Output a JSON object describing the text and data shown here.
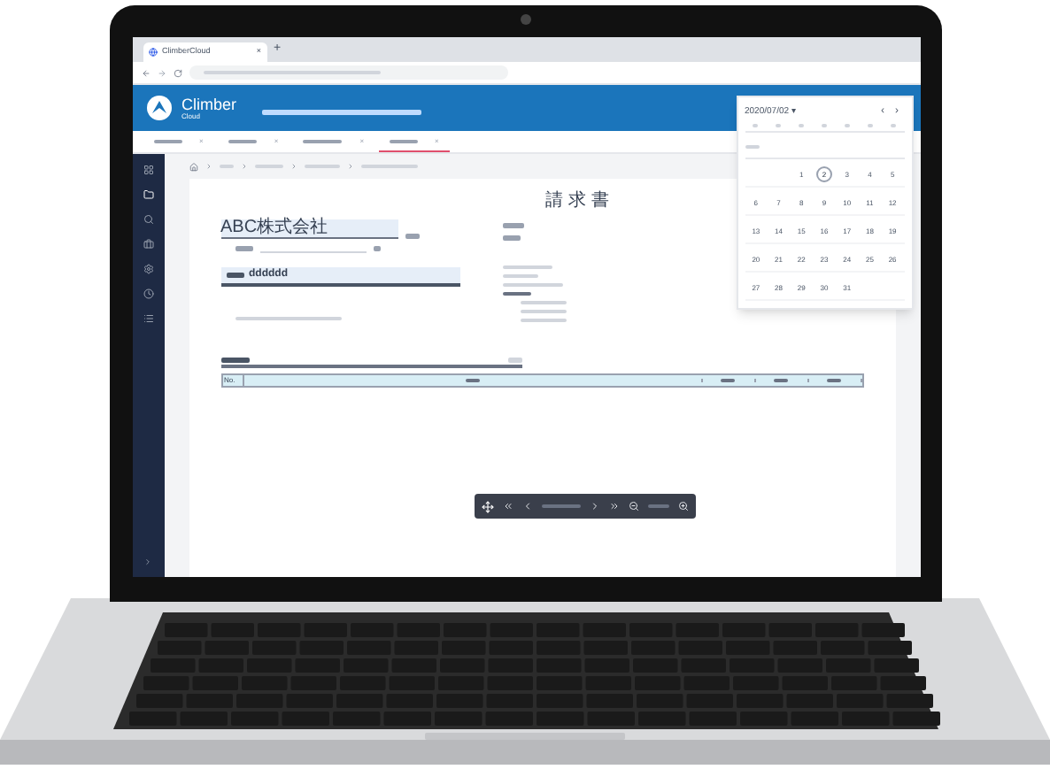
{
  "browser": {
    "tab_title": "ClimberCloud",
    "close": "×",
    "new_tab": "+"
  },
  "header": {
    "logo_main": "Climber",
    "logo_sub": "Cloud"
  },
  "app_tabs": [
    {
      "close": "×",
      "selected": false
    },
    {
      "close": "×",
      "selected": false
    },
    {
      "close": "×",
      "selected": false
    },
    {
      "close": "×",
      "selected": true
    }
  ],
  "document": {
    "title": "請 求 書",
    "customer": "ABC株式会社",
    "subject": "dddddd",
    "first_column": "No."
  },
  "calendar": {
    "month_label": "2020/07/02 ▾",
    "prev": "‹",
    "next": "›",
    "weeks": [
      [
        {
          "day": "1",
          "selected": false
        },
        {
          "day": "2",
          "selected": true
        },
        {
          "day": "3",
          "selected": false
        },
        {
          "day": "4",
          "selected": false
        },
        {
          "day": "5",
          "selected": false
        }
      ],
      [
        {
          "day": "6",
          "selected": false
        },
        {
          "day": "7",
          "selected": false
        },
        {
          "day": "8",
          "selected": false
        },
        {
          "day": "9",
          "selected": false
        },
        {
          "day": "10",
          "selected": false
        },
        {
          "day": "11",
          "selected": false
        },
        {
          "day": "12",
          "selected": false
        }
      ],
      [
        {
          "day": "13",
          "selected": false
        },
        {
          "day": "14",
          "selected": false
        },
        {
          "day": "15",
          "selected": false
        },
        {
          "day": "16",
          "selected": false
        },
        {
          "day": "17",
          "selected": false
        },
        {
          "day": "18",
          "selected": false
        },
        {
          "day": "19",
          "selected": false
        }
      ],
      [
        {
          "day": "20",
          "selected": false
        },
        {
          "day": "21",
          "selected": false
        },
        {
          "day": "22",
          "selected": false
        },
        {
          "day": "23",
          "selected": false
        },
        {
          "day": "24",
          "selected": false
        },
        {
          "day": "25",
          "selected": false
        },
        {
          "day": "26",
          "selected": false
        }
      ],
      [
        {
          "day": "27",
          "selected": false
        },
        {
          "day": "28",
          "selected": false
        },
        {
          "day": "29",
          "selected": false
        },
        {
          "day": "30",
          "selected": false
        },
        {
          "day": "31",
          "selected": false
        }
      ]
    ]
  }
}
